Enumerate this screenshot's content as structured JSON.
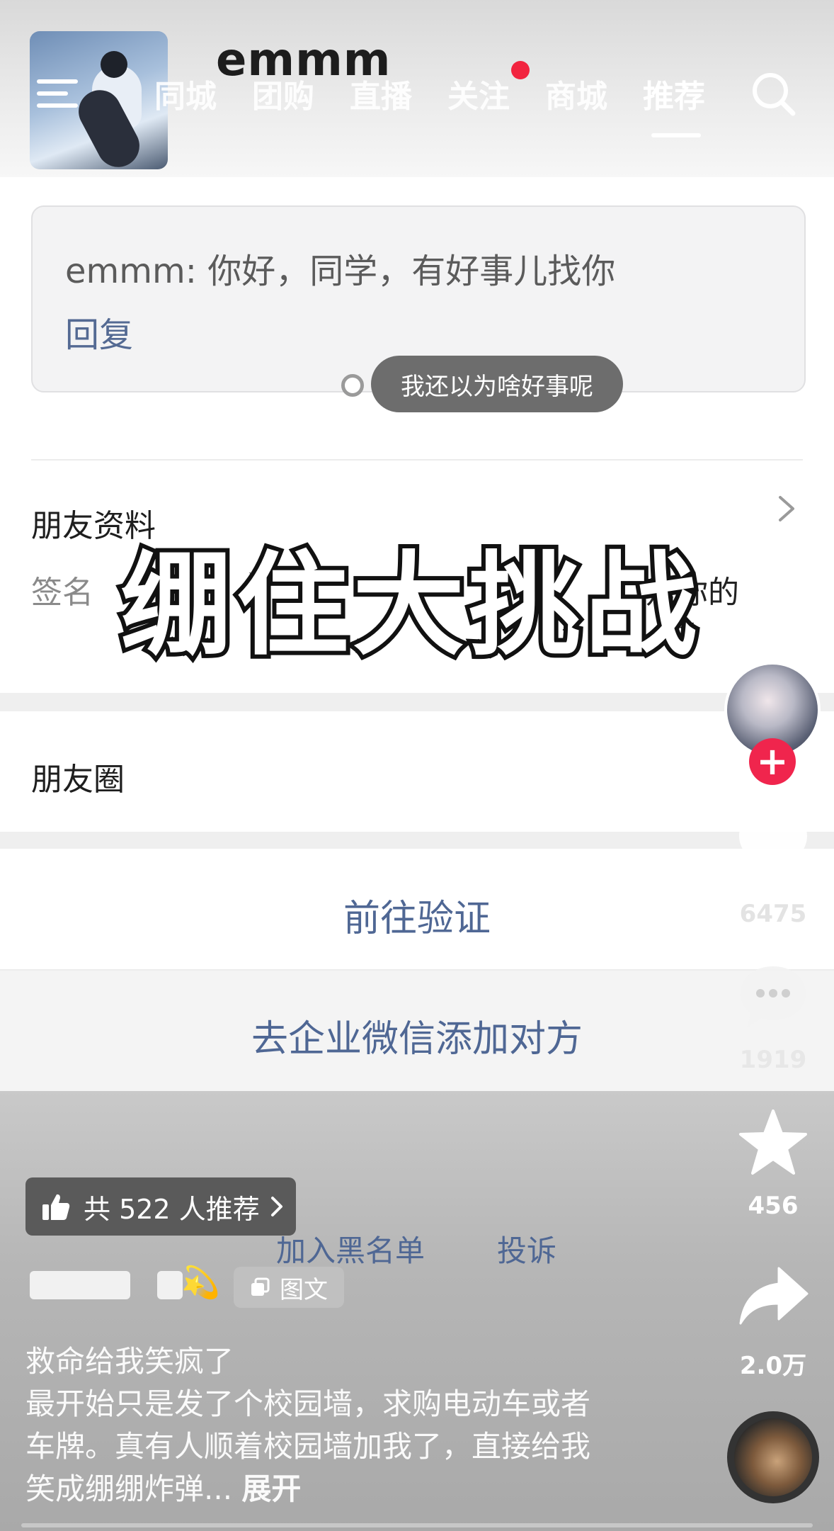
{
  "header": {
    "chat_title": "emmm",
    "nav_tabs": [
      "同城",
      "团购",
      "直播",
      "关注",
      "商城",
      "推荐"
    ],
    "active_tab": "推荐"
  },
  "chat": {
    "message": "emmm: 你好，同学，有好事儿找你",
    "reply_label": "回复"
  },
  "danmaku": "我还以为啥好事呢",
  "friend_info": {
    "title": "朋友资料",
    "signature_label": "签名",
    "signature_visible_tail": "是你的"
  },
  "overlay_caption": "绷住大挑战",
  "moments_label": "朋友圈",
  "actions": {
    "verify": "前往验证",
    "enterprise_add": "去企业微信添加对方",
    "blacklist": "加入黑名单",
    "report": "投诉"
  },
  "recommend": {
    "label": "共 522 人推荐"
  },
  "post": {
    "tag": "图文",
    "author_emoji": "💫",
    "description_lines": [
      "救命给我笑疯了",
      "最开始只是发了个校园墙，求购电动车或者",
      "车牌。真有人顺着校园墙加我了，直接给我",
      "笑成绷绷炸弹..."
    ],
    "expand_label": "展开"
  },
  "rail": {
    "likes": "6475",
    "comments": "1919",
    "favorites": "456",
    "shares": "2.0万"
  },
  "colors": {
    "accent_red": "#f0254d",
    "link_blue": "#4f6794",
    "notification_dot": "#f2243f"
  },
  "icons": [
    "menu-icon",
    "search-icon",
    "chevron-right-icon",
    "heart-icon",
    "comment-icon",
    "star-icon",
    "share-icon",
    "thumbs-up-icon",
    "plus-icon",
    "document-icon",
    "music-disc-icon"
  ]
}
